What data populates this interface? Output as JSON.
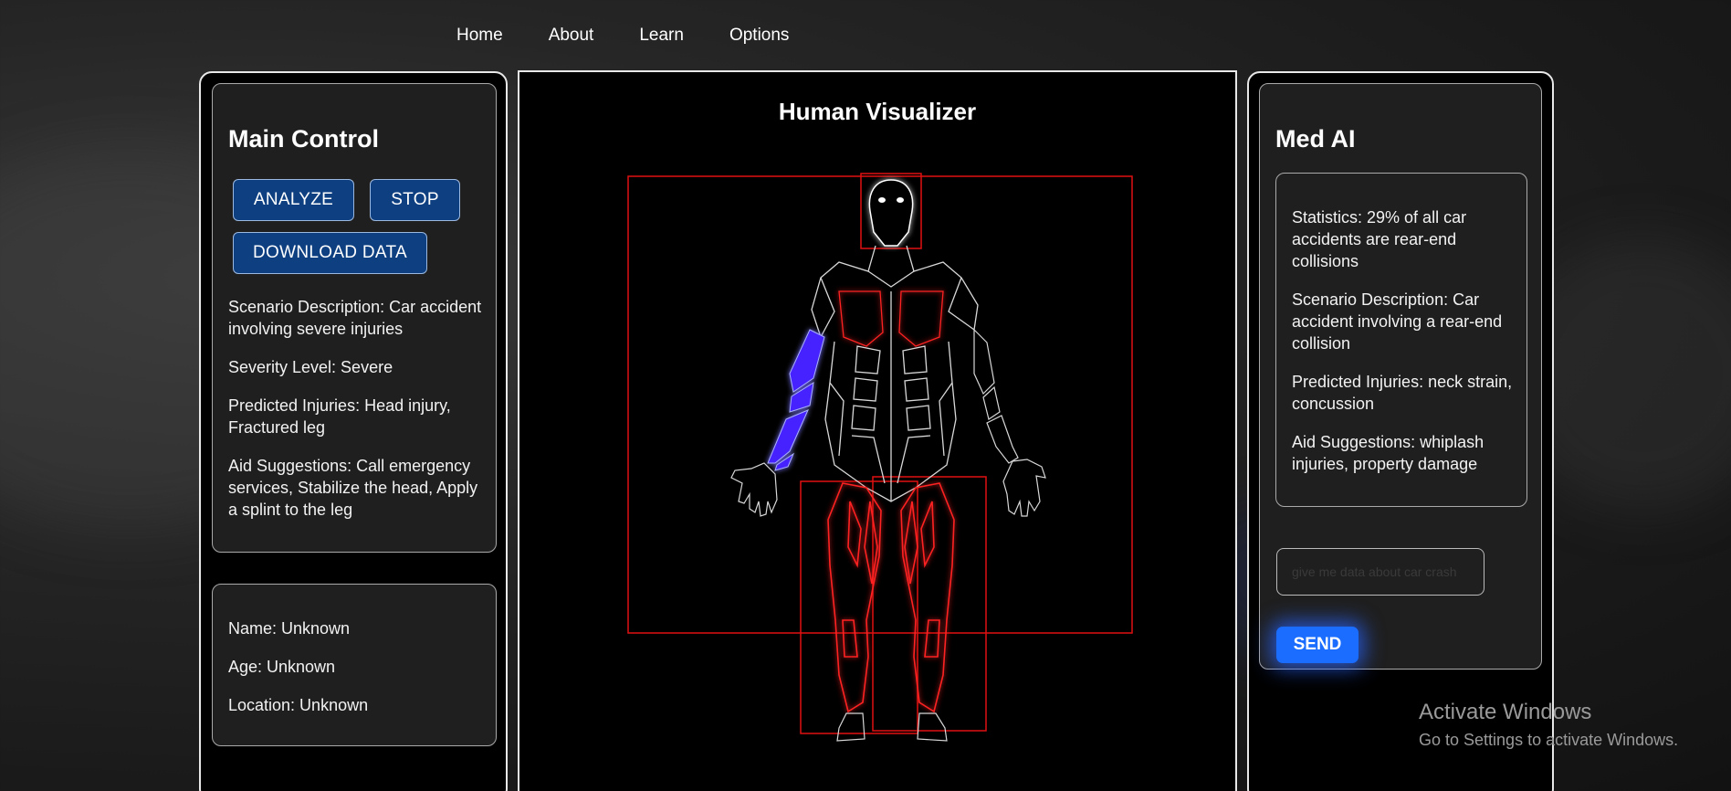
{
  "nav": {
    "items": [
      "Home",
      "About",
      "Learn",
      "Options"
    ]
  },
  "main_control": {
    "title": "Main Control",
    "buttons": {
      "analyze": "ANALYZE",
      "stop": "STOP",
      "download": "DOWNLOAD DATA"
    },
    "scenario": "Scenario Description: Car accident involving severe injuries",
    "severity": "Severity Level: Severe",
    "injuries": "Predicted Injuries: Head injury, Fractured leg",
    "aid": "Aid Suggestions: Call emergency services, Stabilize the head, Apply a splint to the leg"
  },
  "patient": {
    "name": "Name: Unknown",
    "age": "Age: Unknown",
    "location": "Location: Unknown"
  },
  "visualizer": {
    "title": "Human Visualizer",
    "highlight_color": "#4422ff",
    "injury_color": "#ff1a1a",
    "highlighted_region": "right-arm"
  },
  "med_ai": {
    "title": "Med AI",
    "statistics": "Statistics: 29% of all car accidents are rear-end collisions",
    "scenario": "Scenario Description: Car accident involving a rear-end collision",
    "injuries": "Predicted Injuries: neck strain, concussion",
    "aid": "Aid Suggestions: whiplash injuries, property damage",
    "input_placeholder": "give me data about car crash",
    "send_label": "SEND",
    "accent_color": "#1a6dff"
  },
  "watermark": {
    "title": "Activate Windows",
    "subtitle": "Go to Settings to activate Windows."
  }
}
